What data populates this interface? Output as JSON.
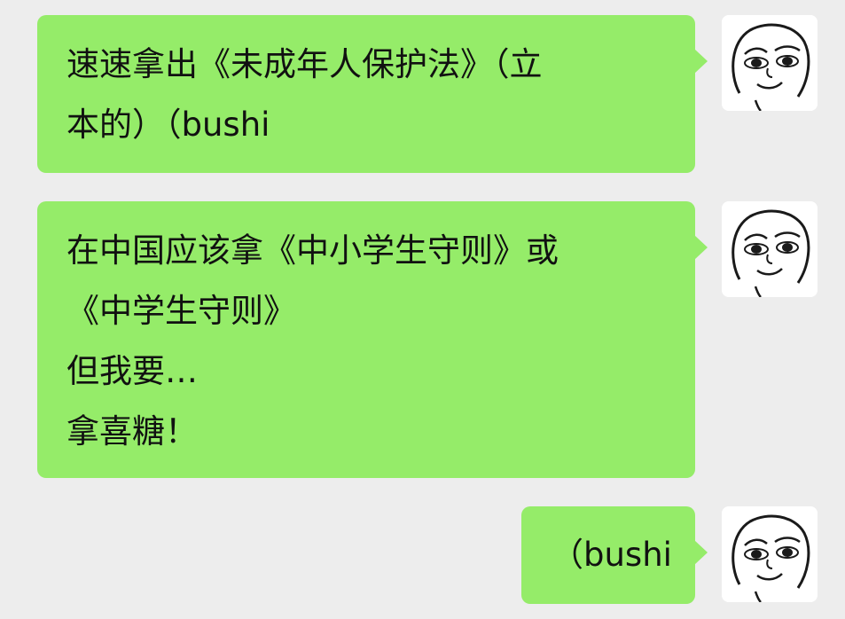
{
  "chat": {
    "messages": [
      {
        "sender": "self",
        "avatar_icon": "meme-face-avatar-icon",
        "lines": [
          "速速拿出《未成年人保护法》（立",
          "本的）（bushi"
        ]
      },
      {
        "sender": "self",
        "avatar_icon": "meme-face-avatar-icon",
        "lines": [
          "在中国应该拿《中小学生守则》或",
          "《中学生守则》",
          "但我要…",
          "拿喜糖！"
        ]
      },
      {
        "sender": "self",
        "avatar_icon": "meme-face-avatar-icon",
        "lines": [
          "（bushi"
        ]
      }
    ]
  },
  "colors": {
    "background": "#ededed",
    "bubble_self": "#95ec69",
    "text": "#111111"
  }
}
